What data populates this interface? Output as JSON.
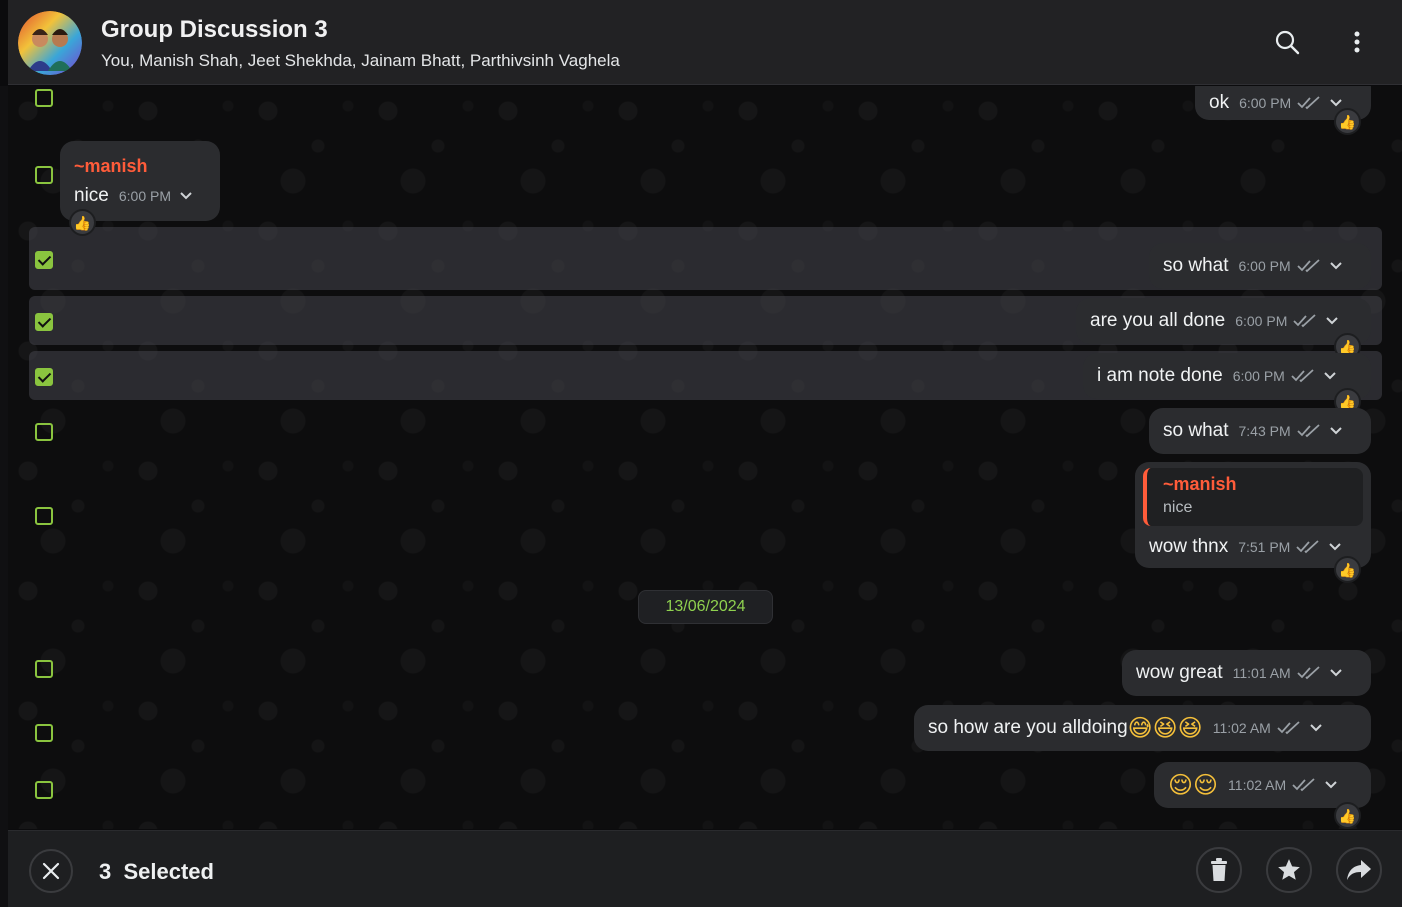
{
  "header": {
    "title": "Group Discussion 3",
    "members": "You, Manish Shah, Jeet Shekhda, Jainam Bhatt, Parthivsinh Vaghela",
    "icons": [
      "search-icon",
      "more-vert-icon"
    ]
  },
  "messages": [
    {
      "text": "ok",
      "time": "6:00 PM",
      "outgoing": true,
      "selected": false,
      "reaction": "👍"
    },
    {
      "sender": "~manish",
      "text": "nice",
      "time": "6:00 PM",
      "outgoing": false,
      "selected": false,
      "reaction": "👍"
    },
    {
      "text": "so what",
      "time": "6:00 PM",
      "outgoing": true,
      "selected": true
    },
    {
      "text": "are you all done",
      "time": "6:00 PM",
      "outgoing": true,
      "selected": true,
      "reaction": "👍"
    },
    {
      "text": "i am note done",
      "time": "6:00 PM",
      "outgoing": true,
      "selected": true,
      "reaction": "👍"
    },
    {
      "text": "so what",
      "time": "7:43 PM",
      "outgoing": true,
      "selected": false
    },
    {
      "quote_sender": "~manish",
      "quote_text": "nice",
      "text": "wow thnx",
      "time": "7:51 PM",
      "outgoing": true,
      "selected": false,
      "reaction": "👍"
    },
    {
      "text": "wow great",
      "time": "11:01 AM",
      "outgoing": true,
      "selected": false
    },
    {
      "text": "so how are you alldoing",
      "emojis": "😅😆😆",
      "time": "11:02 AM",
      "outgoing": true,
      "selected": false
    },
    {
      "text": "",
      "emojis": "😌😌",
      "time": "11:02 AM",
      "outgoing": true,
      "selected": false,
      "reaction": "👍"
    }
  ],
  "date_divider": "13/06/2024",
  "footer": {
    "selected_count": "3",
    "selected_label": "Selected",
    "icons": [
      "close-icon",
      "delete-icon",
      "star-icon",
      "forward-icon"
    ]
  },
  "colors": {
    "accent_green": "#8ac43f",
    "sender_orange": "#ff5c3a",
    "bubble": "#2b2c2f",
    "header": "#222224"
  }
}
